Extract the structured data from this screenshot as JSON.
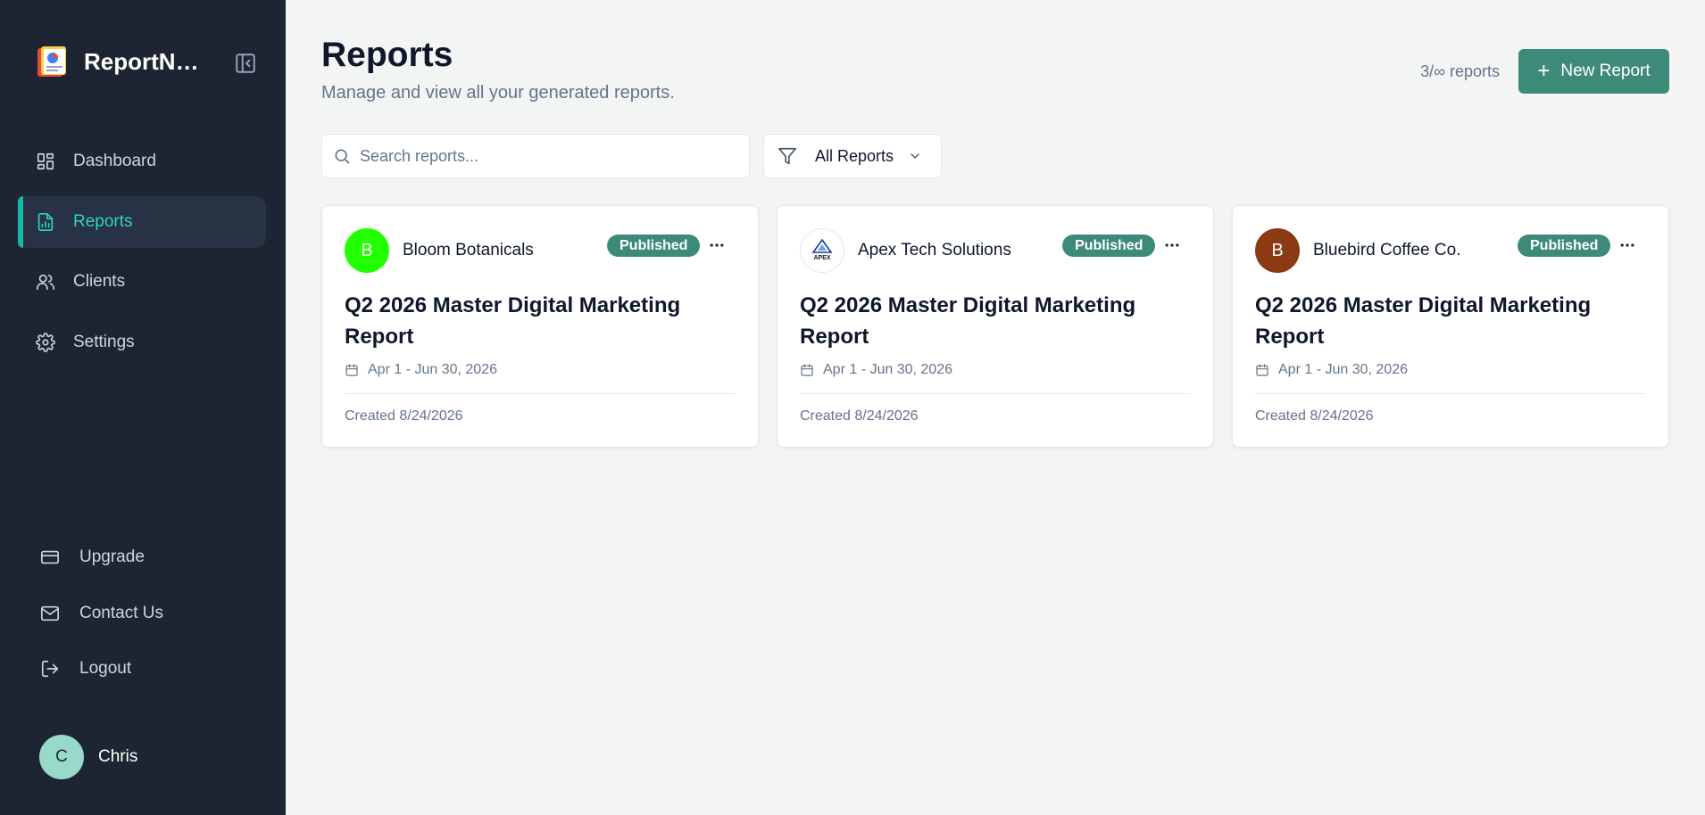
{
  "brand": {
    "name": "ReportNest"
  },
  "nav": [
    {
      "label": "Dashboard",
      "icon": "dashboard-icon",
      "active": false
    },
    {
      "label": "Reports",
      "icon": "file-chart-icon",
      "active": true
    },
    {
      "label": "Clients",
      "icon": "users-icon",
      "active": false
    },
    {
      "label": "Settings",
      "icon": "gear-icon",
      "active": false
    }
  ],
  "bottom_nav": [
    {
      "label": "Upgrade",
      "icon": "credit-card-icon"
    },
    {
      "label": "Contact Us",
      "icon": "mail-icon"
    },
    {
      "label": "Logout",
      "icon": "logout-icon"
    }
  ],
  "user": {
    "initial": "C",
    "name": "Chris"
  },
  "header": {
    "title": "Reports",
    "subtitle": "Manage and view all your generated reports.",
    "count": "3/∞ reports",
    "new_label": "New Report"
  },
  "search": {
    "placeholder": "Search reports...",
    "value": ""
  },
  "filter": {
    "selected": "All Reports"
  },
  "colors": {
    "accent": "#3d8a78",
    "sidebar_bg": "#1e2532",
    "active_text": "#2dd4bf"
  },
  "reports": [
    {
      "client": "Bloom Botanicals",
      "avatar_initial": "B",
      "avatar_color": "#22ff00",
      "status": "Published",
      "title": "Q2 2026 Master Digital Marketing Report",
      "date_range": "Apr 1 - Jun 30, 2026",
      "created": "Created 8/24/2026"
    },
    {
      "client": "Apex Tech Solutions",
      "avatar_initial": "",
      "avatar_logo_text": "APEX",
      "avatar_color": "#ffffff",
      "status": "Published",
      "title": "Q2 2026 Master Digital Marketing Report",
      "date_range": "Apr 1 - Jun 30, 2026",
      "created": "Created 8/24/2026"
    },
    {
      "client": "Bluebird Coffee Co.",
      "avatar_initial": "B",
      "avatar_color": "#8b3a14",
      "status": "Published",
      "title": "Q2 2026 Master Digital Marketing Report",
      "date_range": "Apr 1 - Jun 30, 2026",
      "created": "Created 8/24/2026"
    }
  ]
}
